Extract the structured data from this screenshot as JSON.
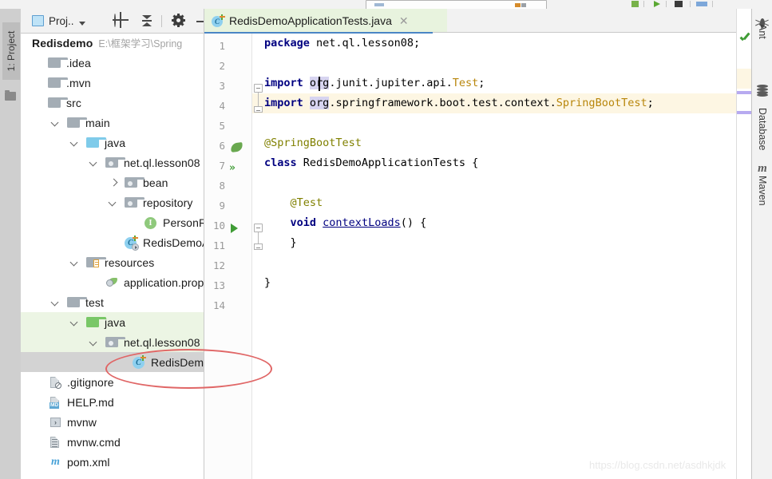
{
  "window": {
    "left_tool_strip": {
      "label": "1: Project",
      "icon": "folder-icon"
    },
    "right_tool_strips": [
      {
        "label": "Ant",
        "icon": "ant-icon"
      },
      {
        "label": "Database",
        "icon": "database-icon"
      },
      {
        "label": "Maven",
        "icon": "maven-m-icon"
      }
    ]
  },
  "project_panel": {
    "title": "Proj..",
    "title_dropdown_icon": "chevron-down-icon",
    "toolbar": [
      {
        "name": "locate-in-tree",
        "icon": "crosshair-target-icon"
      },
      {
        "name": "collapse-all",
        "icon": "collapse-all-icon"
      },
      {
        "name": "settings",
        "icon": "gear-icon"
      },
      {
        "name": "hide",
        "icon": "minimize-icon"
      }
    ],
    "tree": [
      {
        "label": "Redisdemo",
        "path": "E:\\框架学习\\Spring",
        "icon": "project-root-icon",
        "indent": 0,
        "arrow": "none",
        "bold": true,
        "state": "normal"
      },
      {
        "label": ".idea",
        "icon": "folder-gray-icon",
        "indent": 1,
        "arrow": "none",
        "state": "normal"
      },
      {
        "label": ".mvn",
        "icon": "folder-gray-icon",
        "indent": 1,
        "arrow": "none",
        "state": "normal"
      },
      {
        "label": "src",
        "icon": "folder-gray-icon",
        "indent": 1,
        "arrow": "none",
        "state": "normal"
      },
      {
        "label": "main",
        "icon": "folder-gray-icon",
        "indent": 2,
        "arrow": "down",
        "state": "normal"
      },
      {
        "label": "java",
        "icon": "folder-source-blue-icon",
        "indent": 3,
        "arrow": "down",
        "state": "normal"
      },
      {
        "label": "net.ql.lesson08",
        "icon": "package-icon",
        "indent": 4,
        "arrow": "down",
        "state": "normal"
      },
      {
        "label": "bean",
        "icon": "package-icon",
        "indent": 5,
        "arrow": "right",
        "state": "normal"
      },
      {
        "label": "repository",
        "icon": "package-icon",
        "indent": 5,
        "arrow": "down",
        "state": "normal"
      },
      {
        "label": "PersonRe",
        "icon": "interface-icon",
        "indent": 6,
        "arrow": "none",
        "state": "normal"
      },
      {
        "label": "RedisDemoA",
        "icon": "class-runnable-icon",
        "indent": 5,
        "arrow": "none",
        "state": "normal"
      },
      {
        "label": "resources",
        "icon": "folder-resources-icon",
        "indent": 3,
        "arrow": "down",
        "state": "normal"
      },
      {
        "label": "application.prop",
        "icon": "properties-file-icon",
        "indent": 4,
        "arrow": "none",
        "state": "normal"
      },
      {
        "label": "test",
        "icon": "folder-gray-icon",
        "indent": 2,
        "arrow": "down",
        "state": "normal"
      },
      {
        "label": "java",
        "icon": "folder-test-source-green-icon",
        "indent": 3,
        "arrow": "down",
        "state": "highlight-green"
      },
      {
        "label": "net.ql.lesson08",
        "icon": "package-icon",
        "indent": 4,
        "arrow": "down",
        "state": "highlight-green"
      },
      {
        "label": "RedisDemoA",
        "icon": "class-test-icon",
        "indent": 5,
        "arrow": "none",
        "state": "selected"
      },
      {
        "label": ".gitignore",
        "icon": "gitignore-file-icon",
        "indent": 1,
        "arrow": "none",
        "state": "normal"
      },
      {
        "label": "HELP.md",
        "icon": "markdown-file-icon",
        "indent": 1,
        "arrow": "none",
        "state": "normal"
      },
      {
        "label": "mvnw",
        "icon": "shell-script-icon",
        "indent": 1,
        "arrow": "none",
        "state": "normal"
      },
      {
        "label": "mvnw.cmd",
        "icon": "text-file-icon",
        "indent": 1,
        "arrow": "none",
        "state": "normal"
      },
      {
        "label": "pom.xml",
        "icon": "maven-pom-icon",
        "indent": 1,
        "arrow": "none",
        "state": "normal"
      }
    ]
  },
  "editor": {
    "tab": {
      "label": "RedisDemoApplicationTests.java",
      "icon": "java-class-test-icon",
      "close_icon": "close-icon"
    },
    "lines": [
      {
        "num": "1",
        "text": "package net.ql.lesson08;"
      },
      {
        "num": "2",
        "text": ""
      },
      {
        "num": "3",
        "text": "import org.junit.jupiter.api.Test;"
      },
      {
        "num": "4",
        "text": "import org.springframework.boot.test.context.SpringBootTest;"
      },
      {
        "num": "5",
        "text": ""
      },
      {
        "num": "6",
        "text": "@SpringBootTest"
      },
      {
        "num": "7",
        "text": "class RedisDemoApplicationTests {"
      },
      {
        "num": "8",
        "text": ""
      },
      {
        "num": "9",
        "text": "    @Test"
      },
      {
        "num": "10",
        "text": "    void contextLoads() {"
      },
      {
        "num": "11",
        "text": "    }"
      },
      {
        "num": "12",
        "text": ""
      },
      {
        "num": "13",
        "text": "}"
      },
      {
        "num": "14",
        "text": ""
      }
    ],
    "gutter_icons": [
      {
        "line": "6",
        "icon": "spring-bean-leaf-icon"
      },
      {
        "line": "7",
        "icon": "run-all-tests-icon"
      },
      {
        "line": "10",
        "icon": "run-test-icon"
      }
    ],
    "markers": {
      "inspection_status_icon": "green-check-icon"
    }
  },
  "annotation": {
    "shape": "red-ellipse",
    "target": "RedisDemoA test class node"
  },
  "watermark": {
    "text": "https://blog.csdn.net/asdhkjdk"
  },
  "colors": {
    "accent_blue": "#4a86c5",
    "tab_green": "#e8f3de",
    "tree_highlight_green": "#ecf5e4",
    "selection_gray": "#d3d3d3",
    "keyword": "#000080",
    "annotation": "#808000",
    "class_name": "#b8860b",
    "caret_line": "#fdf6e3",
    "ellipse_red": "#e06666"
  }
}
